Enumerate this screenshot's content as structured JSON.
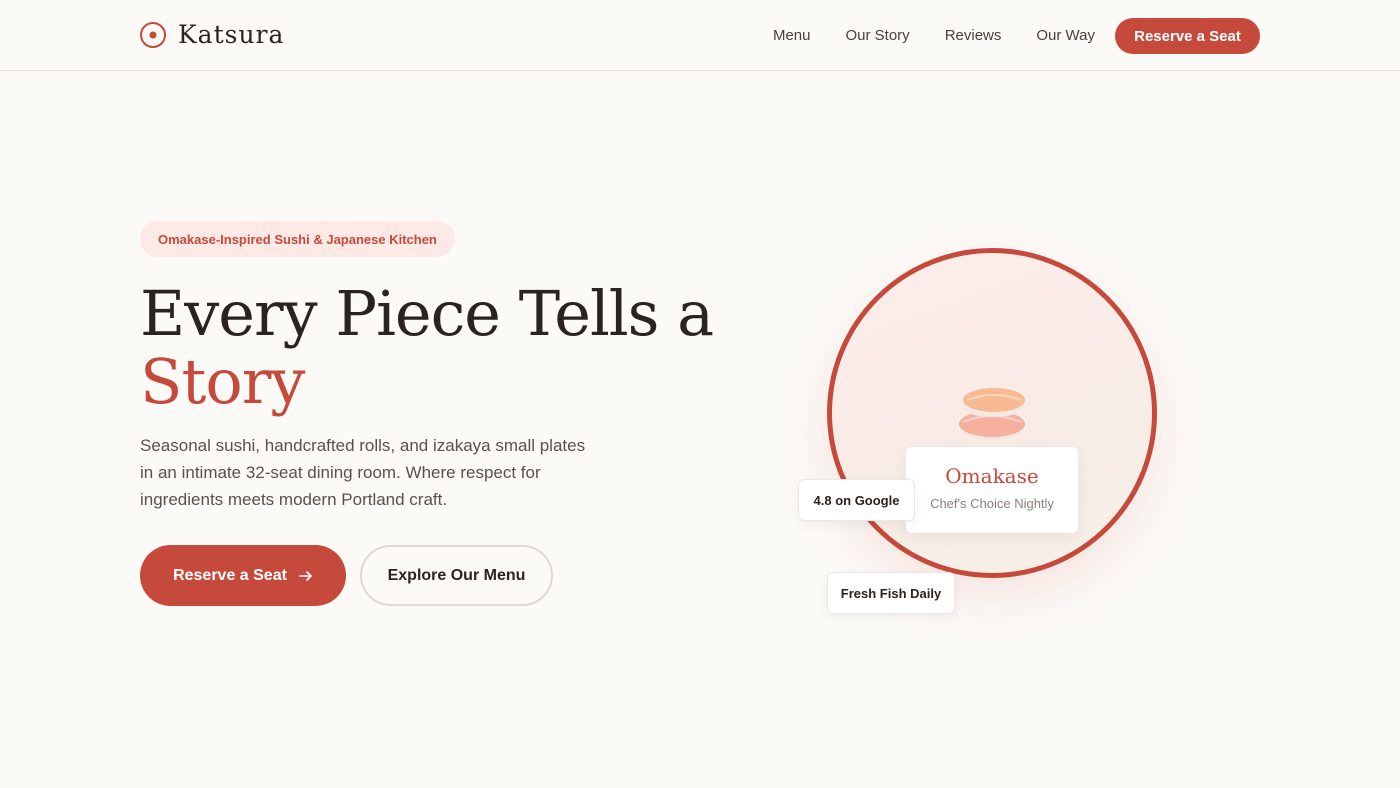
{
  "brand": {
    "name": "Katsura"
  },
  "nav": {
    "links": [
      "Menu",
      "Our Story",
      "Reviews",
      "Our Way"
    ],
    "cta": "Reserve a Seat"
  },
  "hero": {
    "badge": "Omakase-Inspired Sushi & Japanese Kitchen",
    "headline_main": "Every Piece Tells a",
    "headline_accent": "Story",
    "lead": "Seasonal sushi, handcrafted rolls, and izakaya small plates in an intimate 32-seat dining room. Where respect for ingredients meets modern Portland craft.",
    "primary_cta": "Reserve a Seat",
    "primary_cta_icon": "arrow-right-icon",
    "secondary_cta": "Explore Our Menu"
  },
  "feature_card": {
    "title": "Omakase",
    "subtitle": "Chef's Choice Nightly",
    "image": "sushi-icon"
  },
  "chips": {
    "rating": "4.8 on Google",
    "fresh": "Fresh Fish Daily"
  },
  "colors": {
    "accent": "#c64a3c",
    "background": "#fcfaf7",
    "badge_bg": "#fde9e6",
    "text": "#2a2320"
  }
}
